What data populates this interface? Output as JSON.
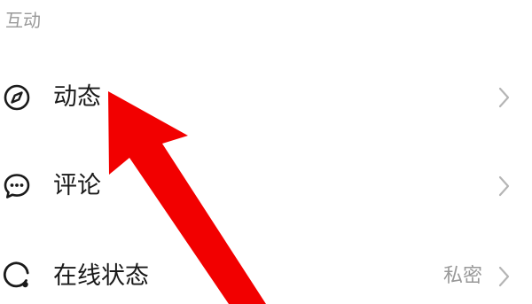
{
  "section": {
    "title": "互动"
  },
  "rows": [
    {
      "label": "动态",
      "icon": "compass-icon",
      "value": ""
    },
    {
      "label": "评论",
      "icon": "comment-bubble-icon",
      "value": ""
    },
    {
      "label": "在线状态",
      "icon": "online-status-icon",
      "value": "私密"
    }
  ],
  "annotation": {
    "arrow_color": "#f20000"
  }
}
